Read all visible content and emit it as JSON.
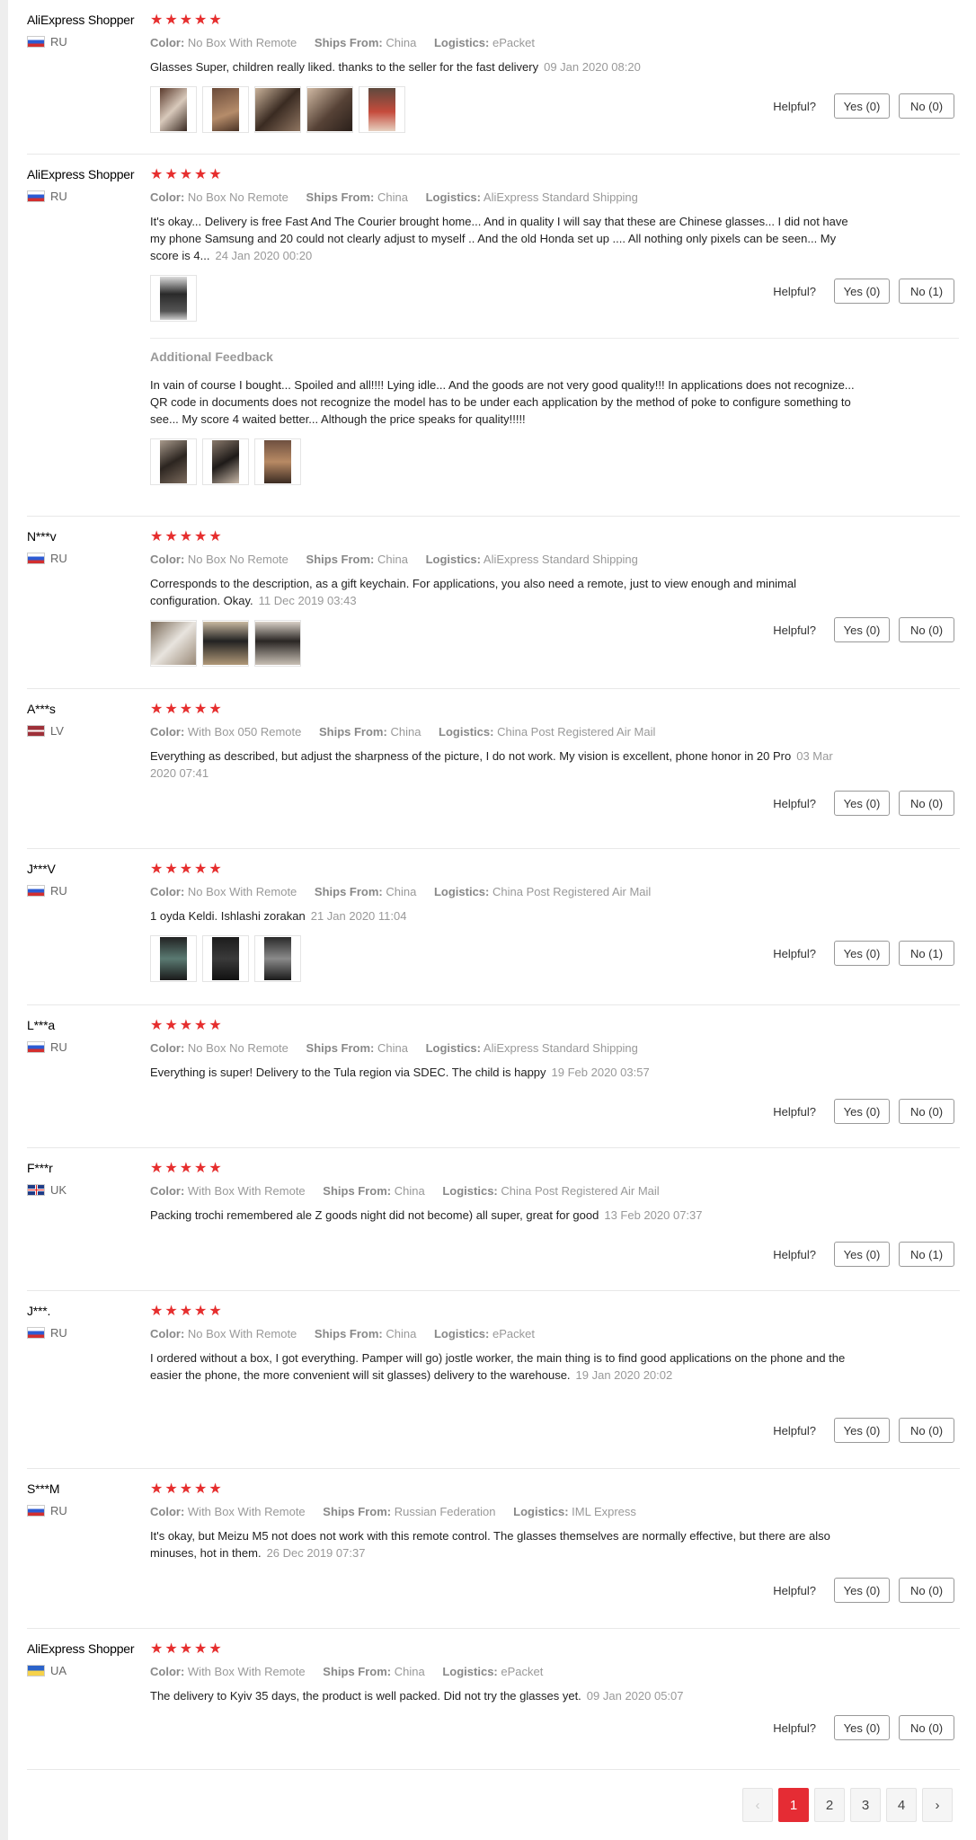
{
  "labels": {
    "color": "Color:",
    "ships_from": "Ships From:",
    "logistics": "Logistics:",
    "helpful": "Helpful?",
    "additional_feedback": "Additional Feedback"
  },
  "reviews": [
    {
      "user": "AliExpress Shopper",
      "country": "RU",
      "stars": 5,
      "color": "No Box With Remote",
      "ships_from": "China",
      "logistics": "ePacket",
      "text": "Glasses Super, children really liked. thanks to the seller for the fast delivery",
      "date": "09 Jan 2020 08:20",
      "yes": "Yes (0)",
      "no": "No (0)"
    },
    {
      "user": "AliExpress Shopper",
      "country": "RU",
      "stars": 5,
      "color": "No Box No Remote",
      "ships_from": "China",
      "logistics": "AliExpress Standard Shipping",
      "text": "It's okay... Delivery is free Fast And The Courier brought home... And in quality I will say that these are Chinese glasses... I did not have my phone Samsung and 20 could not clearly adjust to myself .. And the old Honda set up .... All nothing only pixels can be seen... My score is 4...",
      "date": "24 Jan 2020 00:20",
      "yes": "Yes (0)",
      "no": "No (1)",
      "additional": "In vain of course I bought... Spoiled and all!!!! Lying idle... And the goods are not very good quality!!! In applications does not recognize... QR code in documents does not recognize the model has to be under each application by the method of poke to configure something to see... My score 4 waited better... Although the price speaks for quality!!!!!"
    },
    {
      "user": "N***v",
      "country": "RU",
      "stars": 5,
      "color": "No Box No Remote",
      "ships_from": "China",
      "logistics": "AliExpress Standard Shipping",
      "text": "Corresponds to the description, as a gift keychain. For applications, you also need a remote, just to view enough and minimal configuration. Okay.",
      "date": "11 Dec 2019 03:43",
      "yes": "Yes (0)",
      "no": "No (0)"
    },
    {
      "user": "A***s",
      "country": "LV",
      "stars": 5,
      "color": "With Box 050 Remote",
      "ships_from": "China",
      "logistics": "China Post Registered Air Mail",
      "text": "Everything as described, but adjust the sharpness of the picture, I do not work. My vision is excellent, phone honor in 20 Pro",
      "date": "03 Mar 2020 07:41",
      "yes": "Yes (0)",
      "no": "No (0)"
    },
    {
      "user": "J***V",
      "country": "RU",
      "stars": 5,
      "color": "No Box With Remote",
      "ships_from": "China",
      "logistics": "China Post Registered Air Mail",
      "text": "1 oyda Keldi. Ishlashi zorakan",
      "date": "21 Jan 2020 11:04",
      "yes": "Yes (0)",
      "no": "No (1)"
    },
    {
      "user": "L***a",
      "country": "RU",
      "stars": 5,
      "color": "No Box No Remote",
      "ships_from": "China",
      "logistics": "AliExpress Standard Shipping",
      "text": "Everything is super! Delivery to the Tula region via SDEC. The child is happy",
      "date": "19 Feb 2020 03:57",
      "yes": "Yes (0)",
      "no": "No (0)"
    },
    {
      "user": "F***r",
      "country": "UK",
      "stars": 5,
      "color": "With Box With Remote",
      "ships_from": "China",
      "logistics": "China Post Registered Air Mail",
      "text": "Packing trochi remembered ale Z goods night did not become) all super, great for good",
      "date": "13 Feb 2020 07:37",
      "yes": "Yes (0)",
      "no": "No (1)"
    },
    {
      "user": "J***.",
      "country": "RU",
      "stars": 5,
      "color": "No Box With Remote",
      "ships_from": "China",
      "logistics": "ePacket",
      "text": "I ordered without a box, I got everything. Pamper will go) jostle worker, the main thing is to find good applications on the phone and the easier the phone, the more convenient will sit glasses) delivery to the warehouse.",
      "date": "19 Jan 2020 20:02",
      "yes": "Yes (0)",
      "no": "No (0)"
    },
    {
      "user": "S***M",
      "country": "RU",
      "stars": 5,
      "color": "With Box With Remote",
      "ships_from": "Russian Federation",
      "logistics": "IML Express",
      "text": "It's okay, but Meizu M5 not does not work with this remote control. The glasses themselves are normally effective, but there are also minuses, hot in them.",
      "date": "26 Dec 2019 07:37",
      "yes": "Yes (0)",
      "no": "No (0)"
    },
    {
      "user": "AliExpress Shopper",
      "country": "UA",
      "stars": 5,
      "color": "With Box With Remote",
      "ships_from": "China",
      "logistics": "ePacket",
      "text": "The delivery to Kyiv 35 days, the product is well packed. Did not try the glasses yet.",
      "date": "09 Jan 2020 05:07",
      "yes": "Yes (0)",
      "no": "No (0)"
    }
  ],
  "pagination": {
    "prev": "‹",
    "pages": [
      "1",
      "2",
      "3",
      "4"
    ],
    "current": "1",
    "next": "›"
  },
  "colors": {
    "star": "#e62e2e",
    "active_page": "#e52c34"
  }
}
